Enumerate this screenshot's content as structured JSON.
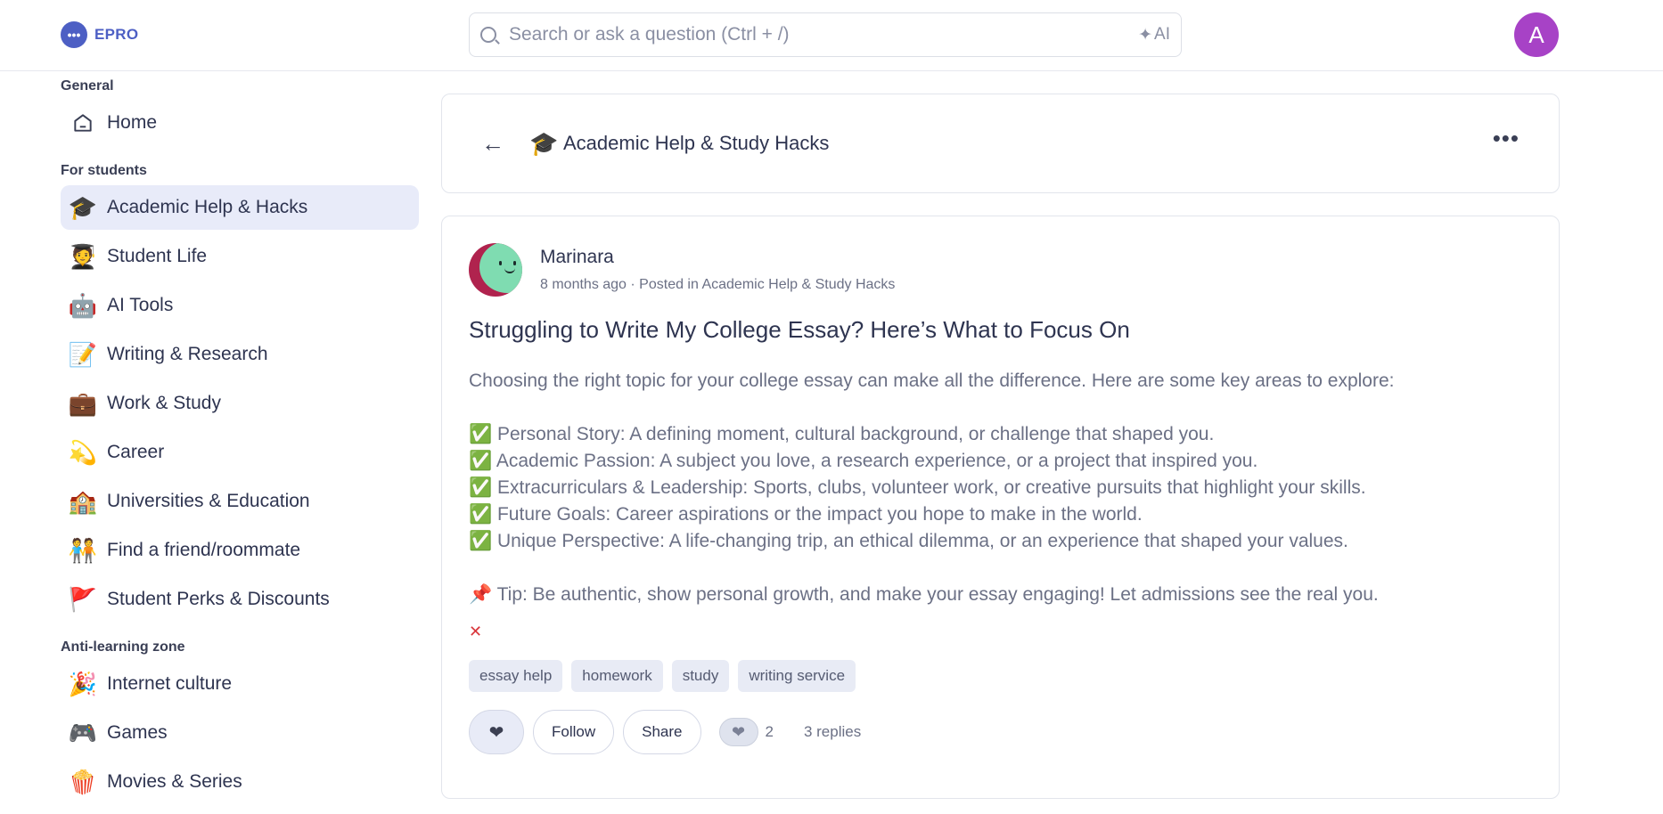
{
  "app": {
    "logo_text": "EPRO",
    "logo_glyph": "•••"
  },
  "search": {
    "placeholder": "Search or ask a question (Ctrl + /)",
    "ai_label": "AI",
    "ai_glyph": "✦"
  },
  "user": {
    "avatar_letter": "A",
    "avatar_color": "#a742c6"
  },
  "sidebar": {
    "sections": [
      {
        "title": "General",
        "items": [
          {
            "label": "Home",
            "icon": "home-icon"
          }
        ]
      },
      {
        "title": "For students",
        "items": [
          {
            "label": "Academic Help & Hacks",
            "emoji": "🎓",
            "active": true
          },
          {
            "label": "Student Life",
            "emoji": "🧑‍🎓"
          },
          {
            "label": "AI Tools",
            "emoji": "🤖"
          },
          {
            "label": "Writing & Research",
            "emoji": "📝"
          },
          {
            "label": "Work & Study",
            "emoji": "💼"
          },
          {
            "label": "Career",
            "emoji": "💫"
          },
          {
            "label": "Universities & Education",
            "emoji": "🏫"
          },
          {
            "label": "Find a friend/roommate",
            "emoji": "🧑‍🤝‍🧑"
          },
          {
            "label": "Student Perks & Discounts",
            "emoji": "🚩"
          }
        ]
      },
      {
        "title": "Anti-learning zone",
        "items": [
          {
            "label": "Internet culture",
            "emoji": "🎉"
          },
          {
            "label": "Games",
            "emoji": "🎮"
          },
          {
            "label": "Movies & Series",
            "emoji": "🍿"
          }
        ]
      }
    ]
  },
  "channel": {
    "emoji": "🎓",
    "title": "Academic Help & Study Hacks",
    "back_glyph": "←",
    "more_glyph": "•••"
  },
  "post": {
    "author": "Marinara",
    "meta": "8 months ago · Posted in Academic Help & Study Hacks",
    "title": "Struggling to Write My College Essay? Here’s What to Focus On",
    "intro": "Choosing the right topic for your college essay can make all the difference. Here are some key areas to explore:",
    "points": [
      "✅ Personal Story: A defining moment, cultural background, or challenge that shaped you.",
      "✅ Academic Passion: A subject you love, a research experience, or a project that inspired you.",
      "✅ Extracurriculars & Leadership: Sports, clubs, volunteer work, or creative pursuits that highlight your skills.",
      "✅ Future Goals: Career aspirations or the impact you hope to make in the world.",
      "✅ Unique Perspective: A life-changing trip, an ethical dilemma, or an experience that shaped your values."
    ],
    "tip": "📌 Tip: Be authentic, show personal growth, and make your essay engaging! Let admissions see the real you.",
    "close_glyph": "✕",
    "tags": [
      "essay help",
      "homework",
      "study",
      "writing service"
    ],
    "actions": {
      "like_glyph": "❤",
      "follow": "Follow",
      "share": "Share",
      "like_count": "2",
      "replies": "3 replies"
    }
  }
}
